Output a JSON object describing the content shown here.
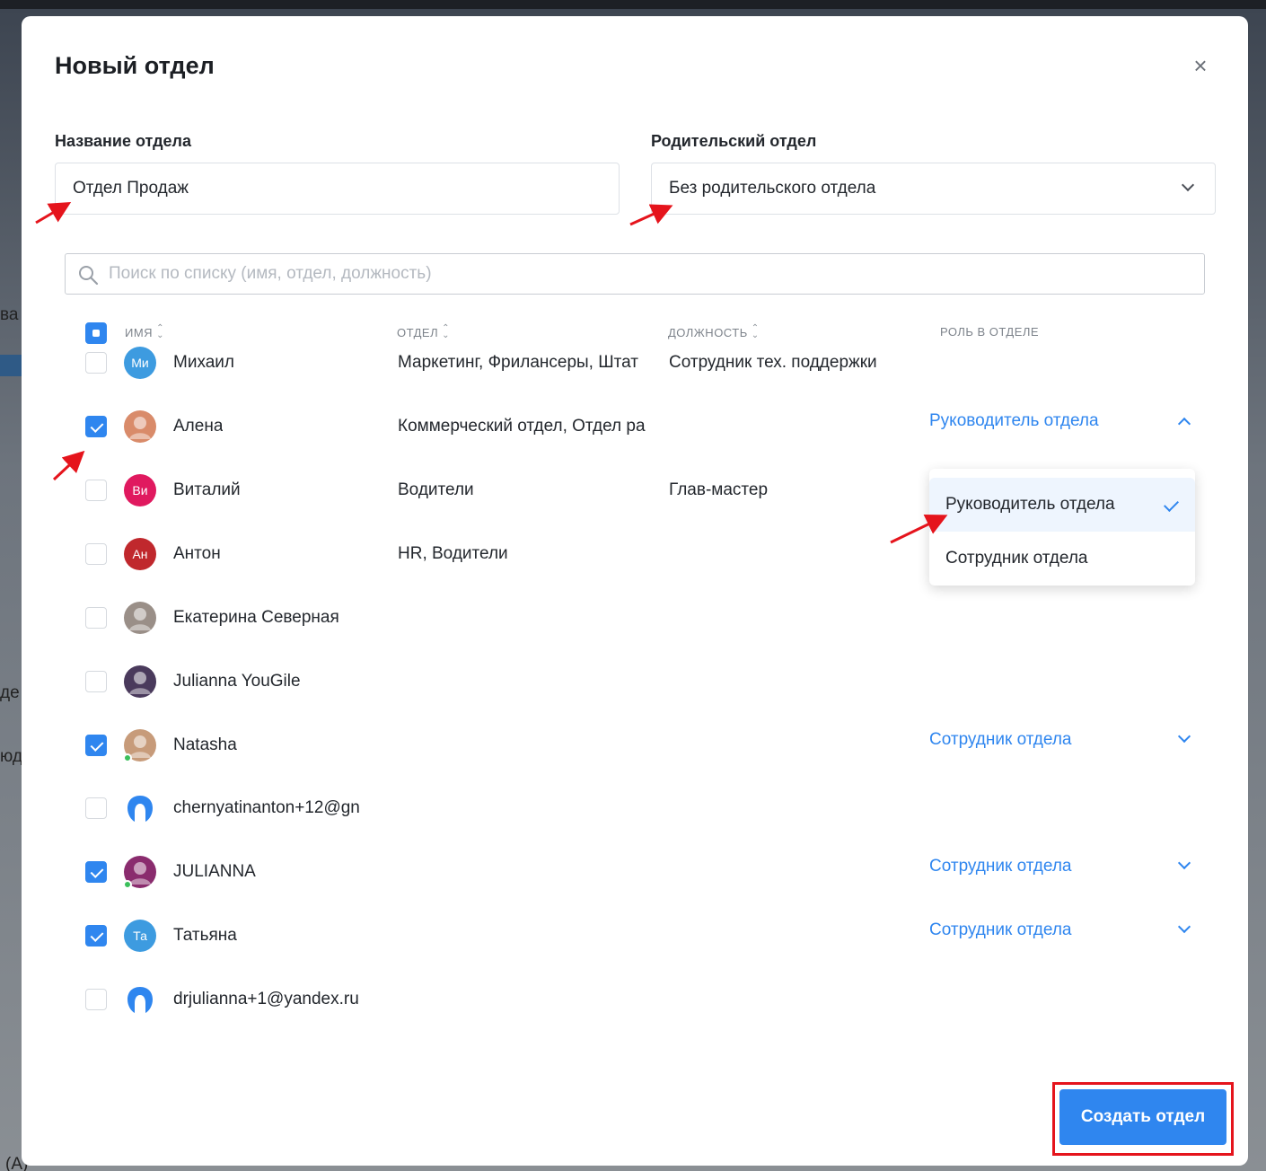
{
  "background": {
    "fragments": [
      "ва",
      "де",
      "юд",
      "(А)"
    ]
  },
  "modal": {
    "title": "Новый отдел",
    "close_label": "×"
  },
  "form": {
    "name_label": "Название отдела",
    "name_value": "Отдел Продаж",
    "parent_label": "Родительский отдел",
    "parent_value": "Без родительского отдела"
  },
  "search": {
    "placeholder": "Поиск по списку (имя, отдел, должность)"
  },
  "table": {
    "headers": {
      "name": "ИМЯ",
      "department": "ОТДЕЛ",
      "position": "ДОЛЖНОСТЬ",
      "role": "РОЛЬ В ОТДЕЛЕ"
    },
    "rows": [
      {
        "name": "Михаил",
        "initials": "Ми",
        "avatar_color": "#3d9be0",
        "department": "Маркетинг, Фрилансеры, Штат",
        "position": "Сотрудник тех. поддержки",
        "role": "",
        "checked": false
      },
      {
        "name": "Алена",
        "initials": "",
        "avatar_color": "#d98b6a",
        "department": "Коммерческий отдел, Отдел ра",
        "position": "",
        "role": "Руководитель отдела",
        "checked": true
      },
      {
        "name": "Виталий",
        "initials": "Ви",
        "avatar_color": "#e0195f",
        "department": "Водители",
        "position": "Глав-мастер",
        "role": "",
        "checked": false
      },
      {
        "name": "Антон",
        "initials": "Ан",
        "avatar_color": "#c0282d",
        "department": "HR, Водители",
        "position": "",
        "role": "",
        "checked": false
      },
      {
        "name": "Екатерина Северная",
        "initials": "",
        "avatar_color": "#9a8f88",
        "department": "",
        "position": "",
        "role": "",
        "checked": false
      },
      {
        "name": "Julianna YouGile",
        "initials": "",
        "avatar_color": "#4a3a5c",
        "department": "",
        "position": "",
        "role": "",
        "checked": false
      },
      {
        "name": "Natasha",
        "initials": "",
        "avatar_color": "#c79b7a",
        "department": "",
        "position": "",
        "role": "Сотрудник отдела",
        "checked": true
      },
      {
        "name": "chernyatinanton+12@gn",
        "initials": "",
        "avatar_color": "#2f86ef",
        "department": "",
        "position": "",
        "role": "",
        "checked": false
      },
      {
        "name": "JULIANNA",
        "initials": "",
        "avatar_color": "#8a2c6e",
        "department": "",
        "position": "",
        "role": "Сотрудник отдела",
        "checked": true
      },
      {
        "name": "Татьяна",
        "initials": "Та",
        "avatar_color": "#3d9be0",
        "department": "",
        "position": "",
        "role": "Сотрудник отдела",
        "checked": true
      },
      {
        "name": "drjulianna+1@yandex.ru",
        "initials": "",
        "avatar_color": "#2f86ef",
        "department": "",
        "position": "",
        "role": "",
        "checked": false
      }
    ]
  },
  "role_dropdown": {
    "options": [
      "Руководитель отдела",
      "Сотрудник отдела"
    ],
    "selected": "Руководитель отдела"
  },
  "create_button": {
    "label": "Создать отдел"
  },
  "colors": {
    "accent": "#2f86ef",
    "highlight_box": "#e5141c",
    "annotation_arrow": "#e5141c"
  }
}
